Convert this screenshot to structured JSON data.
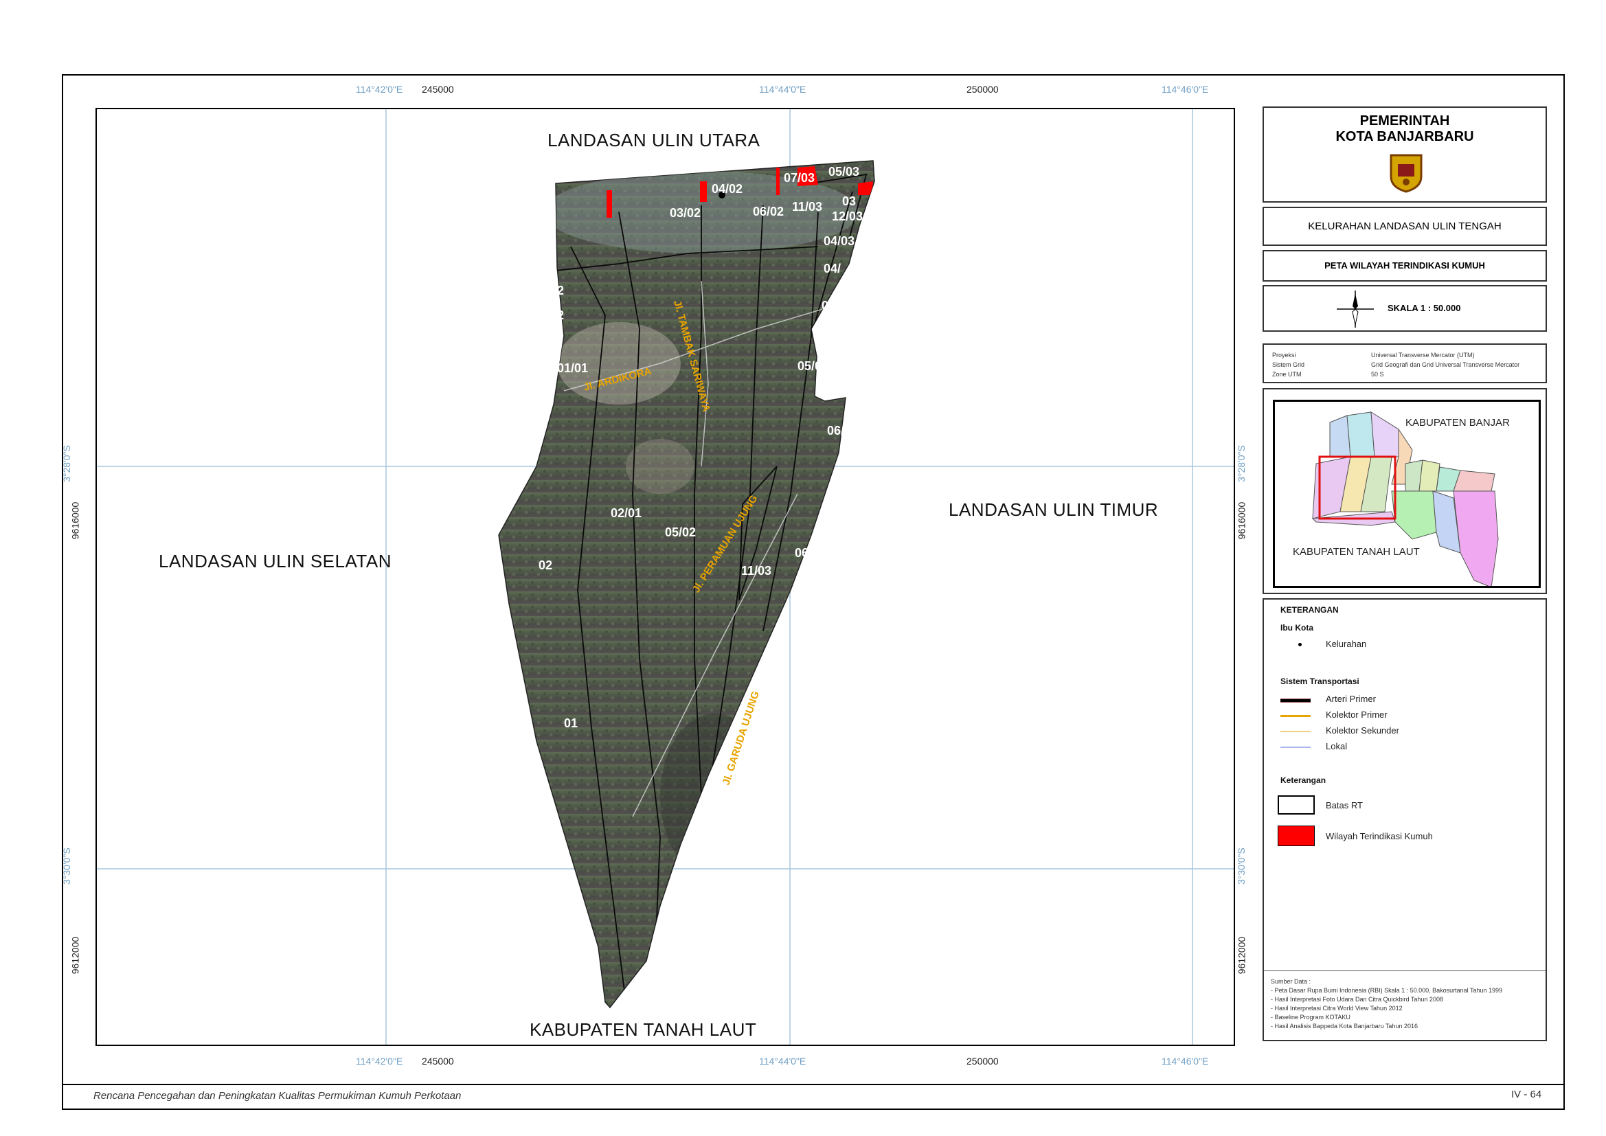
{
  "map": {
    "region_labels": {
      "north": "LANDASAN ULIN UTARA",
      "east": "LANDASAN ULIN TIMUR",
      "west": "LANDASAN ULIN SELATAN",
      "south": "KABUPATEN TANAH LAUT"
    },
    "graticule": {
      "top_lon": [
        "114°42'0\"E",
        "114°44'0\"E",
        "114°46'0\"E"
      ],
      "top_utm": [
        "245000",
        "250000"
      ],
      "bottom_lon": [
        "114°42'0\"E",
        "114°44'0\"E",
        "114°46'0\"E"
      ],
      "bottom_utm": [
        "245000",
        "250000"
      ],
      "left_lat": [
        "3°28'0\"S",
        "3°30'0\"S"
      ],
      "left_utm": [
        "9616000",
        "9612000"
      ],
      "right_lat": [
        "3°28'0\"S",
        "3°30'0\"S"
      ],
      "right_utm": [
        "9616000",
        "9612000"
      ]
    },
    "rt_labels": [
      "07/03",
      "05/03",
      "03/02",
      "06/02",
      "11/03",
      "12/03",
      "04/03",
      "02",
      "02",
      "01/01",
      "05/02",
      "06/",
      "02/01",
      "05/02",
      "02",
      "11/03",
      "06/",
      "01",
      "06/",
      "06/",
      "04/02",
      "04/0",
      "03",
      "04/"
    ],
    "street_labels": [
      "Jl. ARDIKORA",
      "Jl. TAMBAK SARIWAYA",
      "Jl. PERAMUAN UJUNG",
      "Jl. GARUDA UJUNG"
    ]
  },
  "panel": {
    "gov_line1": "PEMERINTAH",
    "gov_line2": "KOTA BANJARBARU",
    "kelurahan": "KELURAHAN LANDASAN ULIN TENGAH",
    "map_title": "PETA WILAYAH TERINDIKASI KUMUH",
    "scale": "SKALA  1 : 50.000",
    "projection": {
      "k1": "Proyeksi",
      "v1": "Universal Transverse Mercator (UTM)",
      "k2": "Sistem Grid",
      "v2": "Grid Geografi dan Grid Universal Transverse Mercator",
      "k3": "Zone UTM",
      "v3": "50 S"
    },
    "inset": {
      "north_label": "KABUPATEN BANJAR",
      "south_label": "KABUPATEN TANAH LAUT"
    },
    "legend": {
      "title": "KETERANGAN",
      "capital_head": "Ibu Kota",
      "capital_item": "Kelurahan",
      "transport_head": "Sistem Transportasi",
      "transport": [
        "Arteri Primer",
        "Kolektor Primer",
        "Kolektor Sekunder",
        "Lokal"
      ],
      "area_head": "Keterangan",
      "boundary": "Batas RT",
      "slum": "Wilayah Terindikasi Kumuh"
    },
    "sources": [
      "Sumber Data :",
      "- Peta Dasar Rupa Bumi Indonesia (RBI) Skala 1 : 50.000, Bakosurtanal Tahun 1999",
      "- Hasil Interpretasi Foto Udara Dan Citra Quickbird Tahun 2008",
      "- Hasil Interpretasi Citra World View Tahun 2012",
      "- Baseline Program KOTAKU",
      "- Hasil Analisis Bappeda Kota Banjarbaru Tahun 2016"
    ]
  },
  "footer": {
    "doc_title": "Rencana Pencegahan dan Peningkatan Kualitas Permukiman Kumuh Perkotaan",
    "page_no": "IV - 64"
  },
  "colors": {
    "grid": "#a9c7dd",
    "slum": "#ff0000",
    "arteri": "#000000",
    "kolektor_primer": "#e8a400",
    "kolektor_sekunder": "#f0d27a",
    "lokal": "#aab4f0",
    "street_label": "#e8a400"
  }
}
